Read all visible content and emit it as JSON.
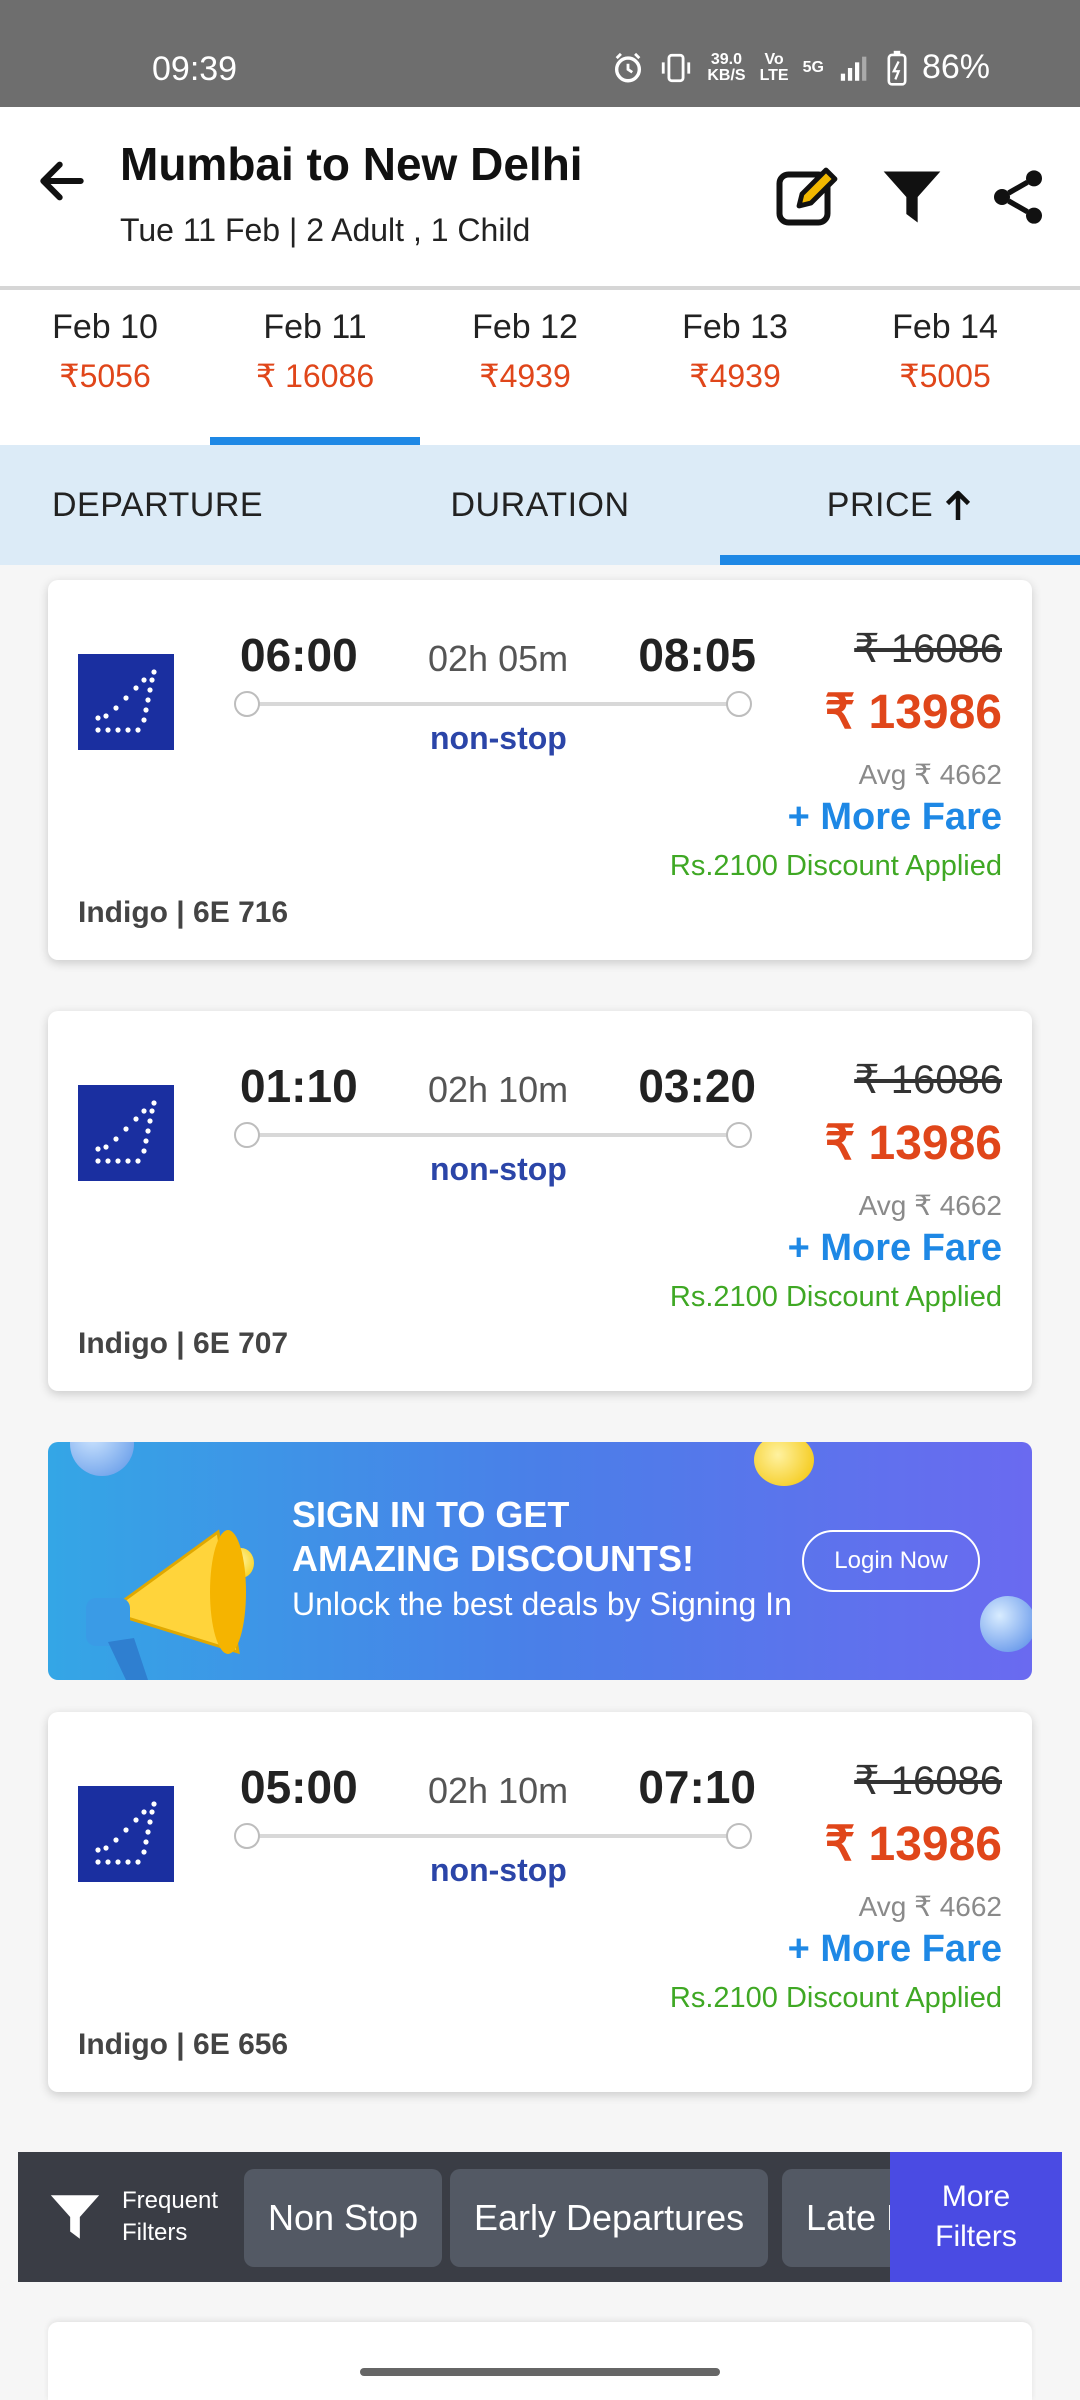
{
  "status_bar": {
    "time": "09:39",
    "net_speed_top": "39.0",
    "net_speed_bottom": "KB/S",
    "volte_top": "Vo",
    "volte_bottom": "LTE",
    "network": "5G",
    "battery": "86%"
  },
  "header": {
    "title": "Mumbai to New Delhi",
    "subtitle": "Tue 11 Feb | 2 Adult , 1 Child"
  },
  "dates": [
    {
      "label": "Feb 10",
      "price": "₹5056"
    },
    {
      "label": "Feb 11",
      "price": "₹ 16086"
    },
    {
      "label": "Feb 12",
      "price": "₹4939"
    },
    {
      "label": "Feb 13",
      "price": "₹4939"
    },
    {
      "label": "Feb 14",
      "price": "₹5005"
    }
  ],
  "sort_tabs": [
    "DEPARTURE",
    "DURATION",
    "PRICE"
  ],
  "flights": [
    {
      "dep": "06:00",
      "duration": "02h 05m",
      "arr": "08:05",
      "stops": "non-stop",
      "old_price": "₹ 16086",
      "price": "₹ 13986",
      "avg": "Avg ₹ 4662",
      "more_fare": "+ More Fare",
      "discount": "Rs.2100 Discount Applied",
      "flight": "Indigo | 6E  716"
    },
    {
      "dep": "01:10",
      "duration": "02h 10m",
      "arr": "03:20",
      "stops": "non-stop",
      "old_price": "₹ 16086",
      "price": "₹ 13986",
      "avg": "Avg ₹ 4662",
      "more_fare": "+ More Fare",
      "discount": "Rs.2100 Discount Applied",
      "flight": "Indigo | 6E  707"
    },
    {
      "dep": "05:00",
      "duration": "02h 10m",
      "arr": "07:10",
      "stops": "non-stop",
      "old_price": "₹ 16086",
      "price": "₹ 13986",
      "avg": "Avg ₹ 4662",
      "more_fare": "+ More Fare",
      "discount": "Rs.2100 Discount Applied",
      "flight": "Indigo | 6E  656"
    }
  ],
  "promo": {
    "line1": "SIGN IN TO GET",
    "line2": "AMAZING DISCOUNTS!",
    "line3": "Unlock the best deals by Signing In",
    "button": "Login Now"
  },
  "filter_bar": {
    "frequent_line1": "Frequent",
    "frequent_line2": "Filters",
    "chips": [
      "Non Stop",
      "Early Departures",
      "Late Departures"
    ],
    "more_line1": "More",
    "more_line2": "Filters"
  },
  "colors": {
    "accent_blue": "#1e88e5",
    "price_red": "#e0461a",
    "discount_green": "#3fa824",
    "stop_blue": "#2b45a8",
    "indigo_logo": "#1a2fa0"
  }
}
